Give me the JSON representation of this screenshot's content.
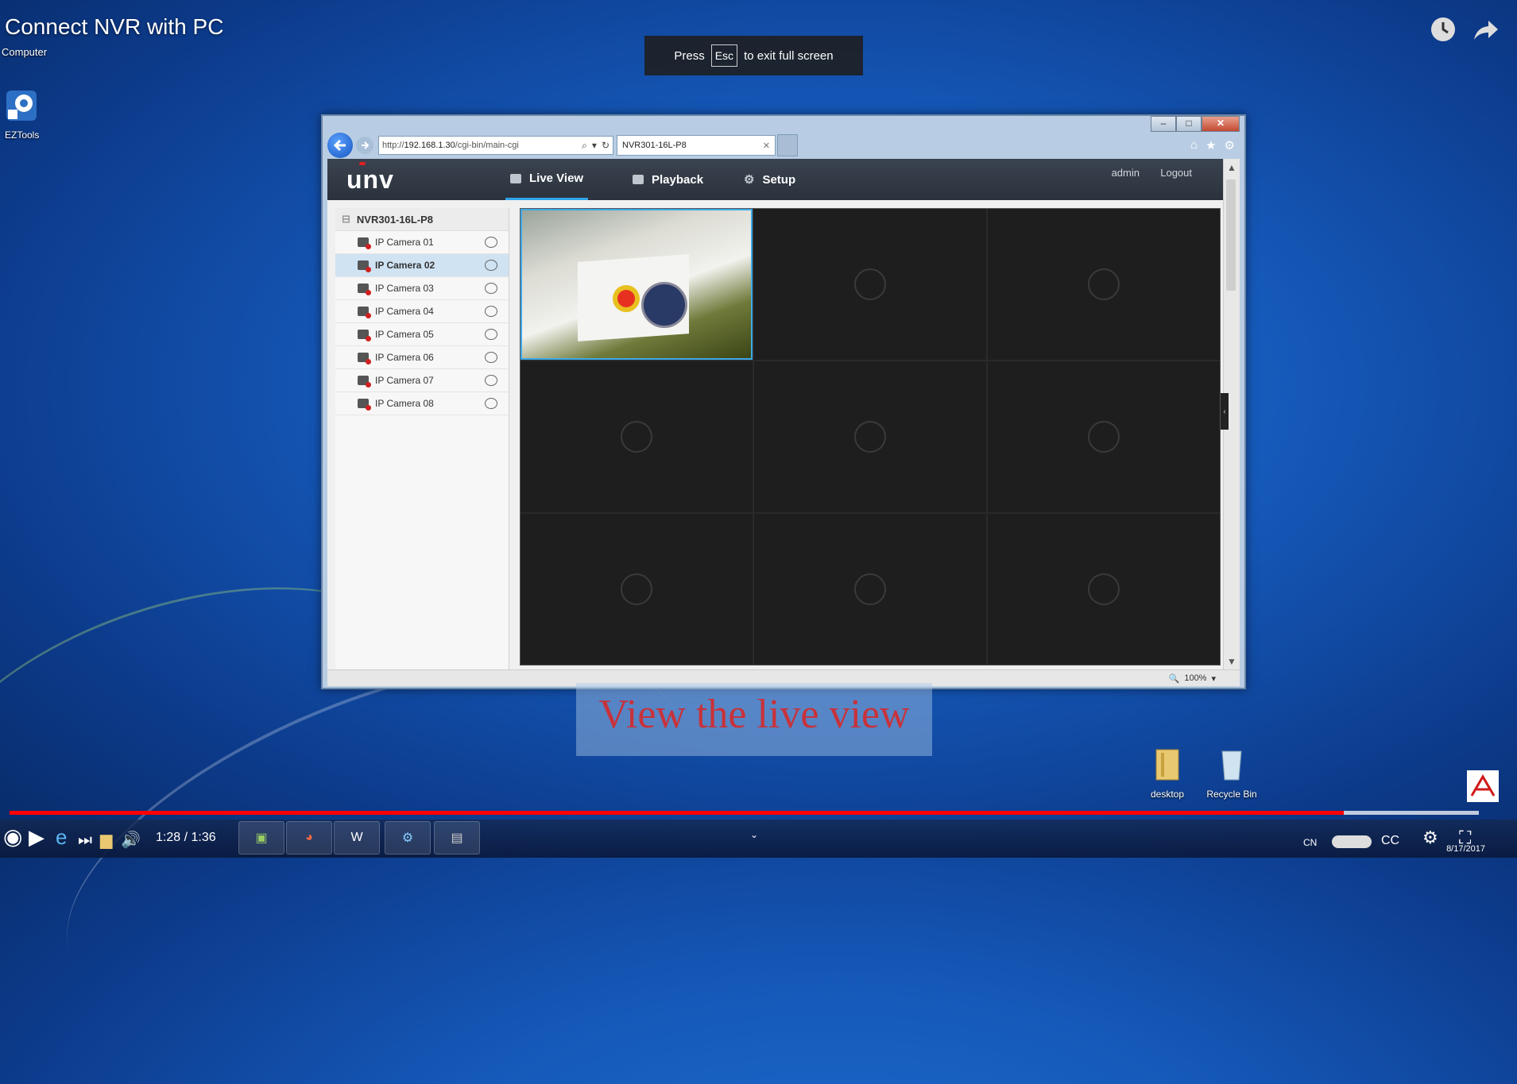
{
  "overlay": {
    "video_title": "Connect NVR with PC",
    "computer_label": "Computer",
    "eztools_label": "EZTools",
    "esc_banner": {
      "press": "Press",
      "key": "Esc",
      "suffix": "to exit full screen"
    }
  },
  "browser": {
    "address_prefix": "http://",
    "address_host": "192.168.1.30",
    "address_path": "/cgi-bin/main-cgi",
    "tab_title": "NVR301-16L-P8",
    "zoom": "100%"
  },
  "app": {
    "logo": "unv",
    "nav": {
      "live_view": "Live View",
      "playback": "Playback",
      "setup": "Setup"
    },
    "user": "admin",
    "logout": "Logout",
    "device": "NVR301-16L-P8",
    "cameras": [
      {
        "label": "IP Camera 01",
        "selected": false
      },
      {
        "label": "IP Camera 02",
        "selected": true
      },
      {
        "label": "IP Camera 03",
        "selected": false
      },
      {
        "label": "IP Camera 04",
        "selected": false
      },
      {
        "label": "IP Camera 05",
        "selected": false
      },
      {
        "label": "IP Camera 06",
        "selected": false
      },
      {
        "label": "IP Camera 07",
        "selected": false
      },
      {
        "label": "IP Camera 08",
        "selected": false
      }
    ]
  },
  "caption": "View the live view",
  "desktop_icons": {
    "desktop": "desktop",
    "recycle_bin": "Recycle Bin"
  },
  "player": {
    "current_time": "1:28",
    "total_time": "1:36",
    "progress": 0.908,
    "buffered": 1.0
  },
  "taskbar": {
    "clock_date": "8/17/2017"
  },
  "colors": {
    "accent": "#2fa3e6",
    "progress": "#ff0000",
    "caption": "#c8323a"
  }
}
